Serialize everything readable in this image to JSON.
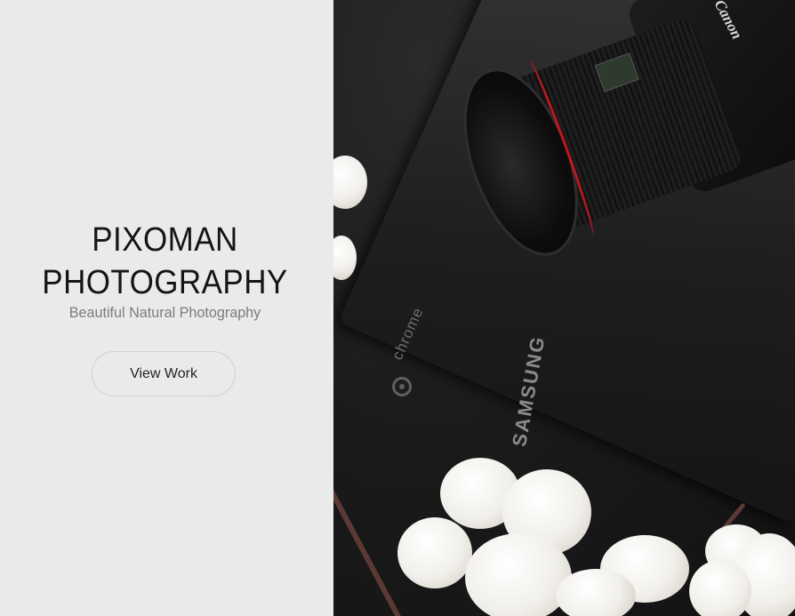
{
  "brand": {
    "title_line1": "PIXOMAN",
    "title_line2": "PHOTOGRAPHY",
    "subtitle": "Beautiful Natural Photography"
  },
  "cta": {
    "label": "View Work"
  },
  "hero_photo": {
    "text_chrome": "chrome",
    "text_samsung": "SAMSUNG",
    "text_canon": "Canon"
  },
  "colors": {
    "left_panel_bg": "#e9eaea",
    "title": "#151515",
    "subtitle": "#7c7c7c",
    "button_border": "#cfd0d0",
    "lens_accent": "#c3161c"
  }
}
